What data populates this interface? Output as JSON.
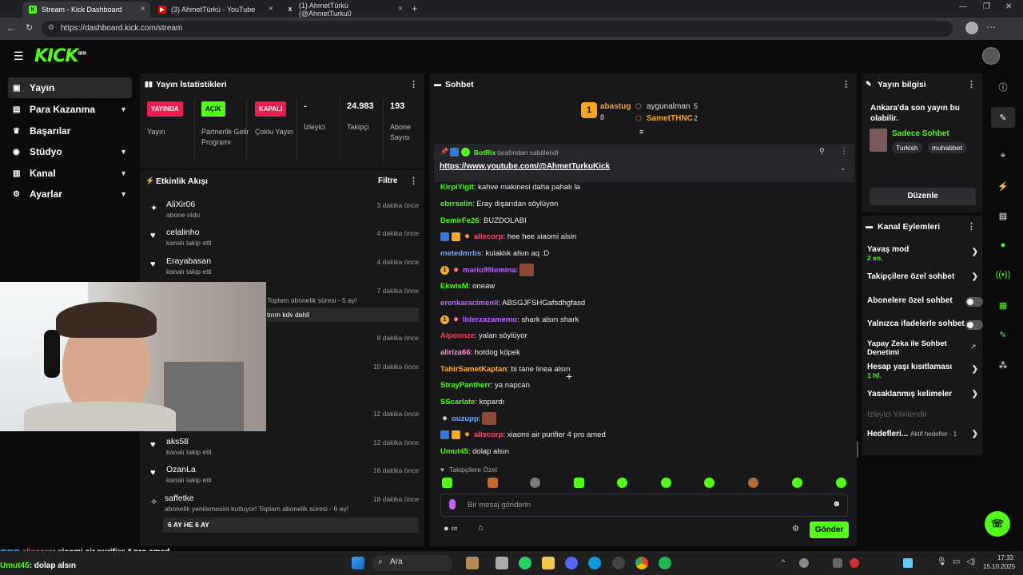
{
  "browser": {
    "tabs": [
      {
        "label": "Stream - Kick Dashboard",
        "fav": "K"
      },
      {
        "label": "(3) AhmetTürkü - YouTube",
        "fav": "▶"
      },
      {
        "label": "(1) AhmetTürkü (@AhmetTurku0",
        "fav": "X"
      }
    ],
    "url": "https://dashboard.kick.com/stream"
  },
  "brand": {
    "logo": "KICK",
    "tag": "BETA"
  },
  "sidebar": {
    "items": [
      {
        "label": "Yayın",
        "icon": "stream-icon"
      },
      {
        "label": "Para Kazanma",
        "icon": "money-icon"
      },
      {
        "label": "Başarılar",
        "icon": "trophy-icon"
      },
      {
        "label": "Stüdyo",
        "icon": "studio-icon"
      },
      {
        "label": "Kanal",
        "icon": "channel-icon"
      },
      {
        "label": "Ayarlar",
        "icon": "gear-icon"
      }
    ]
  },
  "stats": {
    "title": "Yayın İstatistikleri",
    "items": [
      {
        "badge": "YAYINDA",
        "label": "Yayın",
        "color": "#e91e4e"
      },
      {
        "badge": "AÇIK",
        "label": "Partnerlik Gelir Programı",
        "color": "#53fc18"
      },
      {
        "badge": "KAPALI",
        "label": "Çoklu Yayın",
        "color": "#e91e4e"
      },
      {
        "badge": "-",
        "label": "İzleyici"
      },
      {
        "badge": "24.983",
        "label": "Takipçi"
      },
      {
        "badge": "193",
        "label": "Abone Sayısı"
      }
    ]
  },
  "activity": {
    "title": "Etkinlik Akışı",
    "filter": "Filtre",
    "items": [
      {
        "name": "AliXir06",
        "sub": "abone oldu",
        "time": "3 dakika önce"
      },
      {
        "name": "celalinho",
        "sub": "kanalı takip etti",
        "time": "4 dakika önce"
      },
      {
        "name": "Erayabasan",
        "sub": "kanalı takip etti",
        "time": "4 dakika önce"
      },
      {
        "name": "",
        "sub": "Toplam abonelik süresi - 5 ay!",
        "time": "7 dakika önce",
        "note": "tırım kdv dahil"
      },
      {
        "name": "",
        "sub": "",
        "time": "8 dakika önce"
      },
      {
        "name": "",
        "sub": "",
        "time": "10 dakika önce"
      },
      {
        "name": "",
        "sub": "",
        "time": "12 dakika önce"
      },
      {
        "name": "aks58",
        "sub": "kanalı takip etti",
        "time": "12 dakika önce"
      },
      {
        "name": "OzanLa",
        "sub": "kanalı takip etti",
        "time": "16 dakika önce"
      },
      {
        "name": "saffetke",
        "sub": "abonelik yenilemesini kutluyor! Toplam abonelik süresi - 6 ay!",
        "time": "18 dakika önce",
        "note": "6 AY HE 6 AY"
      }
    ]
  },
  "chat": {
    "title": "Sohbet",
    "leaders": [
      {
        "rank": "1",
        "name": "abastug",
        "count": "8"
      },
      {
        "name": "aygunalman",
        "count": "5"
      },
      {
        "name": "SametTHNC",
        "count": "2"
      }
    ],
    "pinned": {
      "by": "BotRix",
      "text": "tarafından sabitlendi",
      "link": "https://www.youtube.com/@AhmetTurkuKick"
    },
    "messages": [
      {
        "user": "KirpiYigit",
        "color": "#53fc18",
        "text": ": kahve makinesi daha pahalı la"
      },
      {
        "user": "ebrrselin",
        "color": "#53fc18",
        "text": ": Eray dışarıdan söylüyon"
      },
      {
        "user": "DemirFe26",
        "color": "#53fc18",
        "text": ": BUZDOLABI"
      },
      {
        "user": "aliscorp",
        "color": "#ff4d6d",
        "text": ": hee hee xiaomi alsin",
        "badges": 3
      },
      {
        "user": "metedmrbs",
        "color": "#6fa8ff",
        "text": ": kulaklık alsın aq :D"
      },
      {
        "user": "mario99lemina",
        "color": "#c362ff",
        "text": ":",
        "badges": 2,
        "emote": true
      },
      {
        "user": "EkwisM",
        "color": "#53fc18",
        "text": ": oneaw"
      },
      {
        "user": "erenkaracimenli",
        "color": "#c362ff",
        "text": ": ABSGJFSHGafsdhgfasd"
      },
      {
        "user": "liderzazamemo",
        "color": "#c362ff",
        "text": ": shark alsın shark",
        "badges": 2
      },
      {
        "user": "Alpoonze",
        "color": "#ff3b5c",
        "text": ": yalan söylüyor"
      },
      {
        "user": "aliriza66",
        "color": "#ff8fe0",
        "text": ": hotdog köpek"
      },
      {
        "user": "TahirSametKaptan",
        "color": "#ffb347",
        "text": ": bi tane linea alsın"
      },
      {
        "user": "StrayPantherr",
        "color": "#53fc18",
        "text": ": ya napcan"
      },
      {
        "user": "SScarlate",
        "color": "#53fc18",
        "text": ": kopardı"
      },
      {
        "user": "ouzupp",
        "color": "#6fa8ff",
        "text": ":",
        "badges": 1,
        "emote": true
      },
      {
        "user": "aliscorp",
        "color": "#ff4d6d",
        "text": ": xiaomi air purifier 4 pro amed",
        "badges": 3
      },
      {
        "user": "Umut45",
        "color": "#53fc18",
        "text": ": dolap alsın"
      }
    ],
    "followers_only": "Takipçilere Özel",
    "input_placeholder": "Bir mesaj gönderin",
    "send": "Gönder"
  },
  "info": {
    "title": "Yayın bilgisi",
    "stream_title": "Ankara'da son yayın bu olabilir.",
    "category": "Sadece Sohbet",
    "tags": [
      "Turkish",
      "muhabbet"
    ],
    "edit": "Düzenle"
  },
  "channel_actions": {
    "title": "Kanal Eylemleri",
    "items": [
      {
        "label": "Yavaş mod",
        "sub": "2 sn.",
        "ctrl": "chevron"
      },
      {
        "label": "Takipçilere özel sohbet",
        "ctrl": "chevron"
      },
      {
        "label": "Abonelere özel sohbet",
        "ctrl": "toggle"
      },
      {
        "label": "Yalnızca ifadelerle sohbet",
        "ctrl": "toggle"
      },
      {
        "label": "Yapay Zeka ile Sohbet Denetimi",
        "ctrl": "external"
      },
      {
        "label": "Hesap yaşı kısıtlaması",
        "sub": "1 hf.",
        "ctrl": "chevron"
      },
      {
        "label": "Yasaklanmış kelimeler",
        "ctrl": "chevron"
      },
      {
        "label": "İzleyici Yönlendir",
        "ctrl": "none"
      },
      {
        "label": "Hedefleri...",
        "sub": "Aktif hedefler - 1",
        "ctrl": "chevron"
      }
    ]
  },
  "overlay": {
    "line1_user": "aliscorp",
    "line1": ": xiaomi air purifier 4 pro amed",
    "line2_user": "Umut45",
    "line2": ": dolap alsın"
  },
  "taskbar": {
    "search": "Ara",
    "time": "17:33",
    "date": "15.10.2025"
  }
}
